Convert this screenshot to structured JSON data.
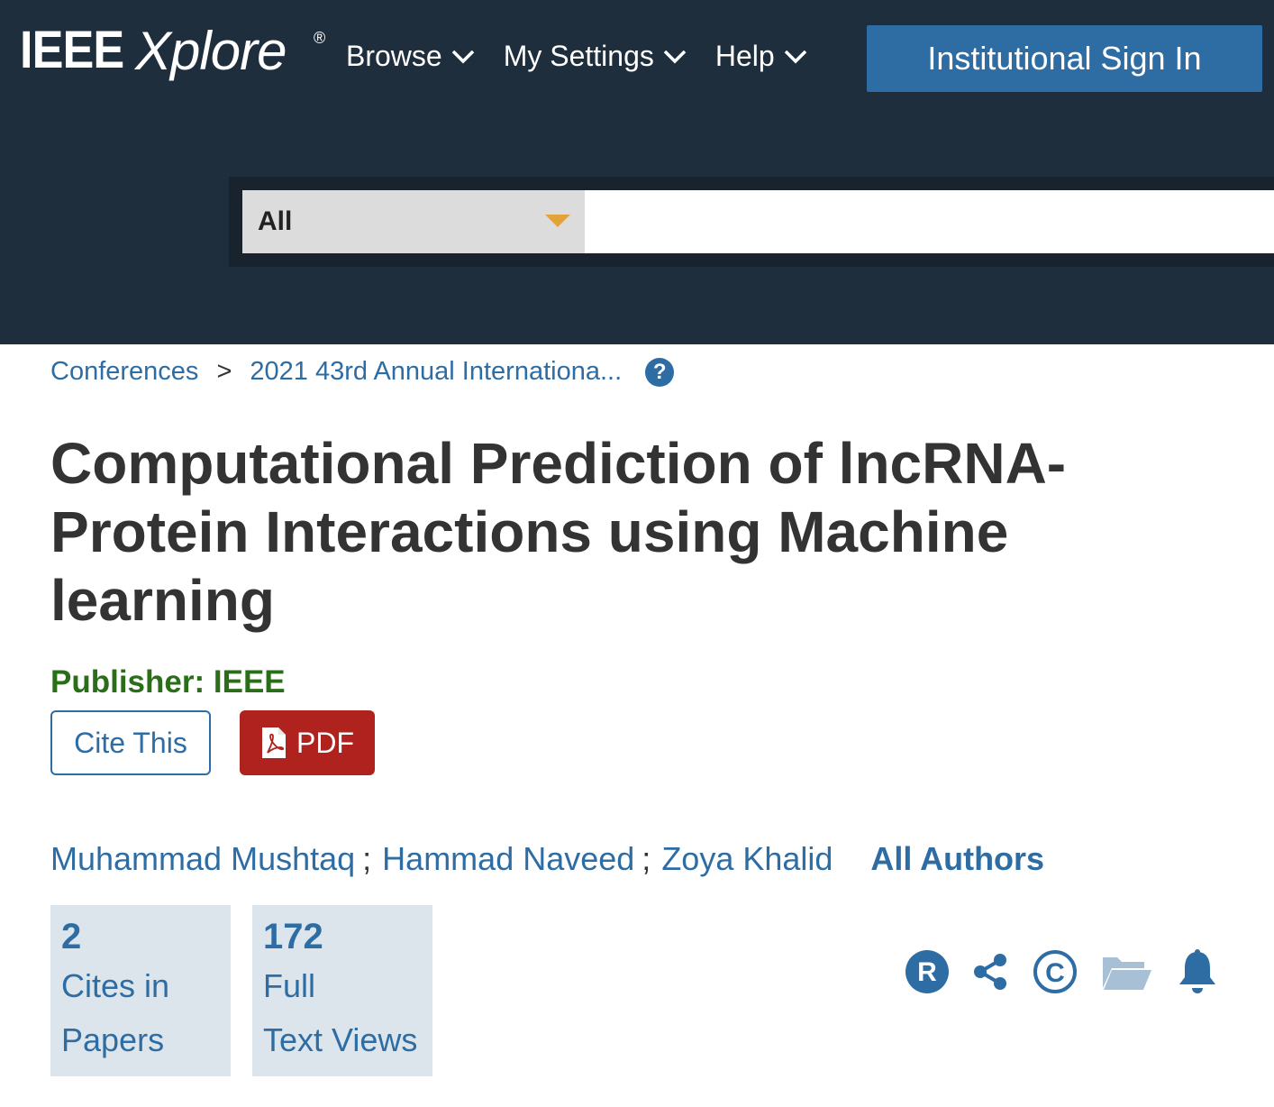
{
  "header": {
    "logo_text": "IEEE",
    "logo_text2": "Xplore",
    "logo_reg": "®",
    "nav": [
      {
        "label": "Browse"
      },
      {
        "label": "My Settings"
      },
      {
        "label": "Help"
      }
    ],
    "signin_label": "Institutional Sign In",
    "search_scope": "All",
    "search_value": ""
  },
  "breadcrumb": {
    "items": [
      "Conferences",
      "2021 43rd Annual Internationa..."
    ],
    "separator": ">",
    "help_glyph": "?"
  },
  "article": {
    "title": "Computational Prediction of lncRNA-Protein Interactions using Machine learning",
    "publisher_label": "Publisher:",
    "publisher_value": "IEEE",
    "cite_label": "Cite This",
    "pdf_label": "PDF"
  },
  "authors": {
    "names": [
      "Muhammad Mushtaq",
      "Hammad Naveed",
      "Zoya Khalid"
    ],
    "separator": ";",
    "all_label": "All Authors"
  },
  "metrics": [
    {
      "value": "2",
      "line1": "Cites in",
      "line2": "Papers"
    },
    {
      "value": "172",
      "line1": "Full",
      "line2": "Text Views"
    }
  ],
  "tools": {
    "icons": [
      "rights-icon",
      "share-icon",
      "copyright-icon",
      "folder-icon",
      "alert-bell-icon"
    ],
    "rights_glyph": "R",
    "copyright_glyph": "C"
  },
  "colors": {
    "header_bg": "#1f2e3d",
    "accent_blue": "#2e6da4",
    "pdf_red": "#b0221e",
    "publisher_green": "#2b6e1a",
    "metric_bg": "#dde5ec",
    "scope_caret": "#e3a33a"
  }
}
